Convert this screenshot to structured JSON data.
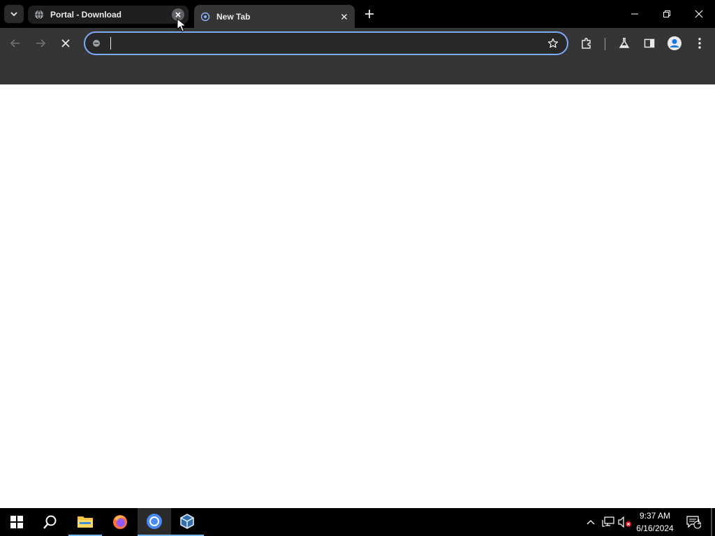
{
  "tabs": [
    {
      "title": "Portal - Download",
      "icon": "globe-icon",
      "active": false
    },
    {
      "title": "New Tab",
      "icon": "chrome-newtab-icon",
      "active": true
    }
  ],
  "omnibox": {
    "value": "",
    "placeholder": ""
  },
  "taskbar": {
    "apps": [
      "start-icon",
      "search-icon",
      "file-explorer-icon",
      "firefox-icon",
      "chrome-icon",
      "virtualbox-icon"
    ],
    "time": "9:37 AM",
    "date": "6/16/2024",
    "notification_count": "1"
  },
  "colors": {
    "accent": "#7cacf8",
    "toolbar": "#353535",
    "tabstrip": "#000000"
  }
}
